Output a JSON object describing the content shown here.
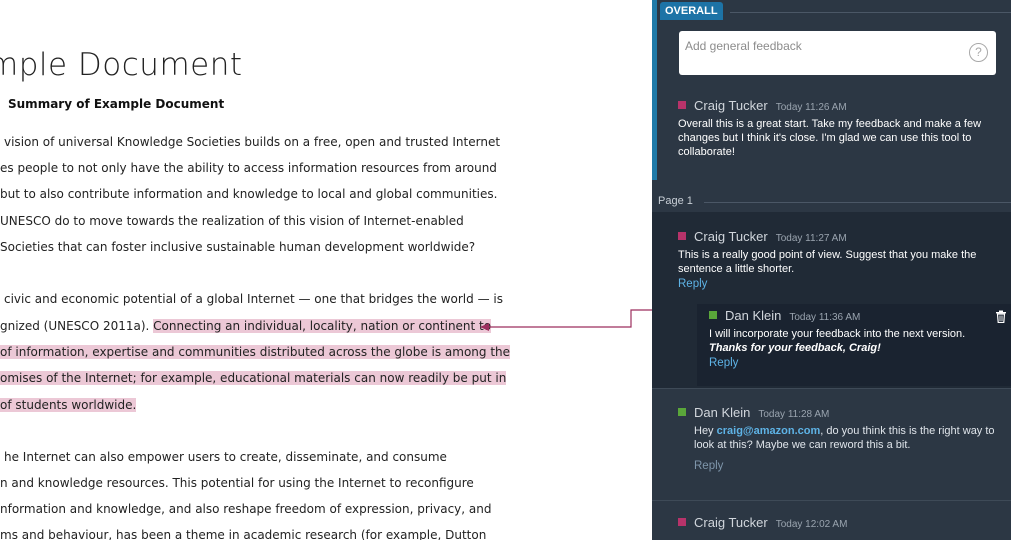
{
  "document": {
    "title": "mple Document",
    "subtitle": "Summary of Example Document",
    "paragraph1": [
      "vision of universal Knowledge Societies builds on a free, open and trusted Internet",
      "es people to not only have the ability to access information resources from around",
      "but to also contribute information and knowledge to local and global communities.",
      "UNESCO do to move towards the realization of this vision of Internet-enabled",
      " Societies that can foster inclusive sustainable human development worldwide?"
    ],
    "paragraph2": {
      "line1": "civic and economic potential of a global Internet — one that bridges the world — is",
      "line2_plain": "gnized (UNESCO 2011a). ",
      "line2_highlight": "Connecting an individual, locality, nation or continent to ",
      "line3_highlight": " of information, expertise and communities distributed across the globe is among the",
      "line4_highlight": "omises of the Internet; for example, educational materials can now readily be put in",
      "line5_highlight": " of students worldwide."
    },
    "paragraph3": [
      "he Internet can also empower users to create, disseminate, and consume",
      "n and knowledge resources. This potential for using the Internet to reconfigure",
      "nformation and knowledge, and also reshape freedom of expression, privacy, and",
      "ms and behaviour, has been a theme in academic research (for example, Dutton"
    ]
  },
  "panel": {
    "overall_tag": "OVERALL",
    "feedback_placeholder": "Add general feedback",
    "help_glyph": "?",
    "page_label": "Page 1",
    "comments": [
      {
        "author": "Craig Tucker",
        "time": "Today 11:26 AM",
        "text": "Overall this is a great start. Take my feedback and make a few changes but I think it's close. I'm glad we can use this tool to collaborate!"
      },
      {
        "author": "Craig Tucker",
        "time": "Today 11:27 AM",
        "text": "This is a really good point of view. Suggest that you make the sentence a little shorter.",
        "reply": "Reply"
      },
      {
        "author": "Dan Klein",
        "time": "Today 11:36 AM",
        "text": "I will incorporate your feedback into the next version.",
        "text_emphasis": "Thanks for your feedback, Craig!",
        "reply": "Reply"
      },
      {
        "author": "Dan Klein",
        "time": "Today 11:28 AM",
        "text_before": "Hey ",
        "mention": "craig@amazon.com",
        "text_after": ", do you think this is the right way to look at this? Maybe we can reword this a bit.",
        "reply": "Reply"
      },
      {
        "author": "Craig Tucker",
        "time": "Today 12:02 AM"
      }
    ]
  },
  "colors": {
    "panel_bg": "#2c3744",
    "highlight": "#ecc8d6",
    "connector": "#9c2f5e",
    "craig_marker": "#b7336a",
    "dan_marker": "#5aa63a",
    "link": "#5eb3e6",
    "overall_tag": "#1d73a6"
  },
  "icons": [
    "help-icon",
    "trash-icon"
  ]
}
